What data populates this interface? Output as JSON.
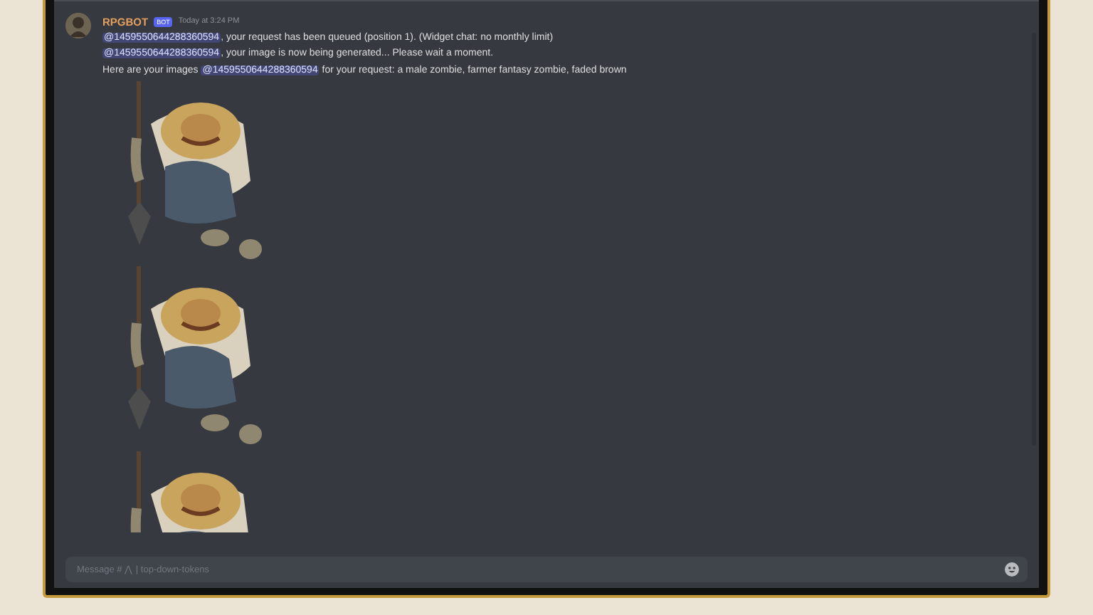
{
  "message": {
    "author": "RPGBOT",
    "badge": "BOT",
    "time": "Today at 3:24 PM",
    "lines": [
      {
        "mention": "@1459550644288360594",
        "after": ", your request has been queued (position 1). (Widget chat: no monthly limit)"
      },
      {
        "mention": "@1459550644288360594",
        "after": ", your image is now being generated... Please wait a moment."
      },
      {
        "mention": "@1459550644288360594",
        "before": "Here are your images ",
        "after": " for your request: a male zombie, farmer fantasy zombie, faded brown"
      }
    ]
  },
  "composer": {
    "placeholder": "Message # ⋀ | top-down-tokens"
  }
}
